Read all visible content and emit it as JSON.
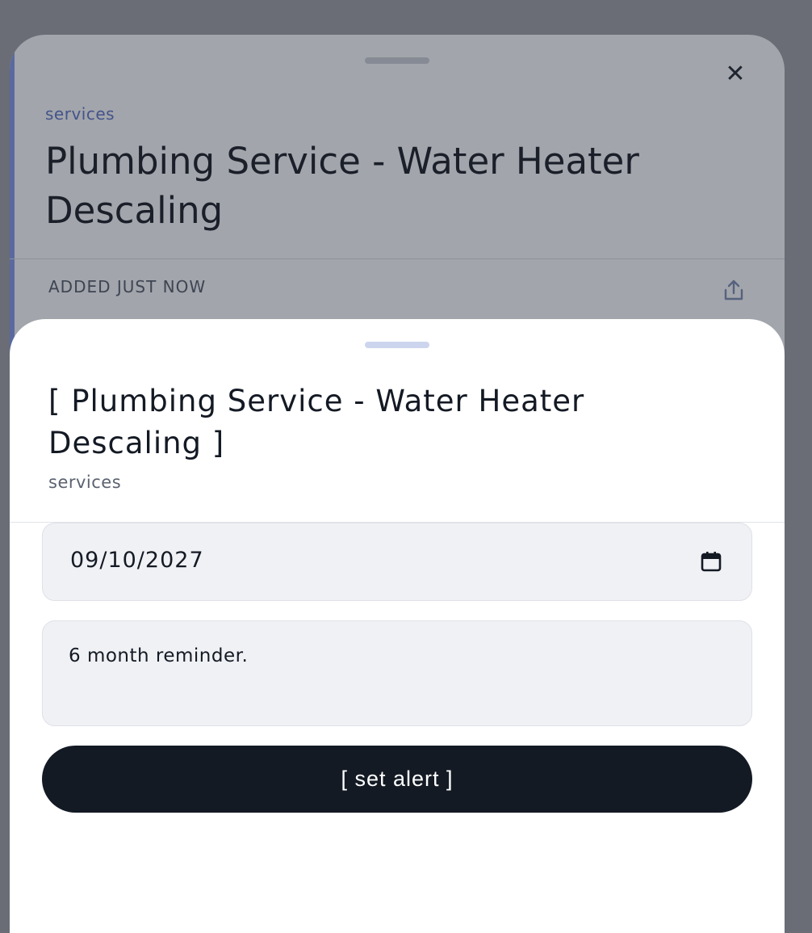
{
  "background_card": {
    "category": "services",
    "title": "Plumbing Service - Water Heater Descaling",
    "added_label": "ADDED JUST NOW",
    "close_icon": "close-icon",
    "share_icon": "share-icon"
  },
  "alert_sheet": {
    "title": "[ Plumbing Service - Water Heater Descaling ]",
    "subtitle": "services",
    "date_value": "09/10/2027",
    "calendar_icon": "calendar-icon",
    "note_value": "6 month reminder.",
    "submit_label": "[ set alert ]"
  },
  "colors": {
    "overlay": "#6a6d76",
    "background_card": "#a2a5ab",
    "accent": "#44548a",
    "button": "#131a24",
    "field": "#f0f1f5"
  }
}
